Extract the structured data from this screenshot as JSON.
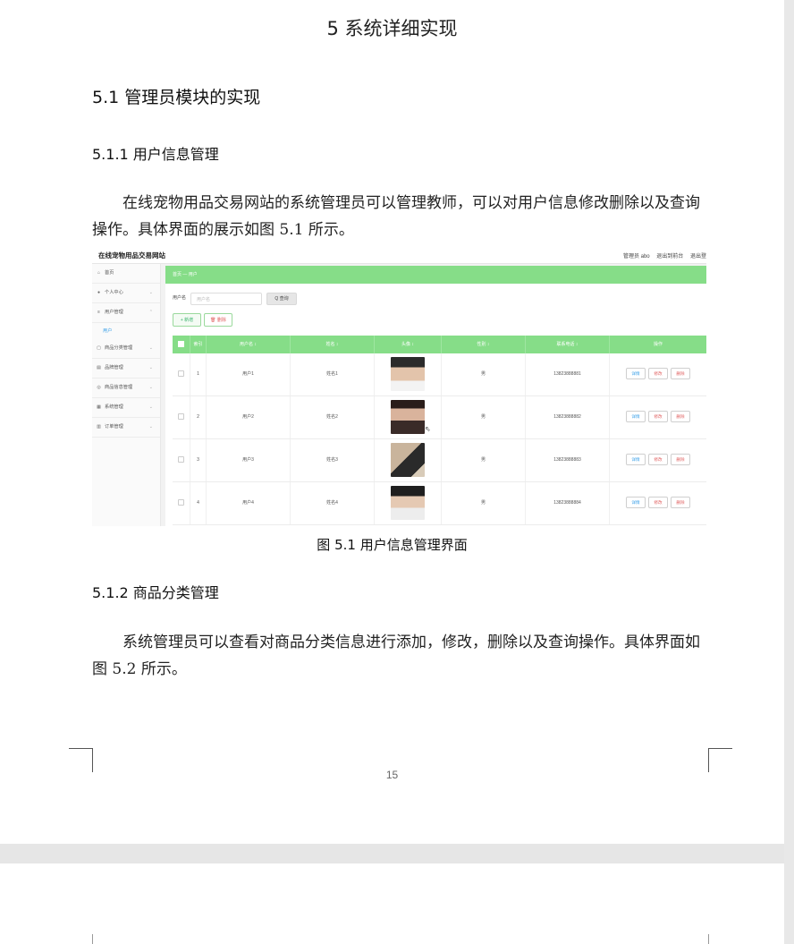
{
  "document": {
    "chapter_title": "5 系统详细实现",
    "section_title": "5.1  管理员模块的实现",
    "subsection_1": "5.1.1  用户信息管理",
    "paragraph_1": "在线宠物用品交易网站的系统管理员可以管理教师，可以对用户信息修改删除以及查询操作。具体界面的展示如图 5.1 所示。",
    "figure_caption": "图 5.1  用户信息管理界面",
    "subsection_2": "5.1.2  商品分类管理",
    "paragraph_2": "系统管理员可以查看对商品分类信息进行添加，修改，删除以及查询操作。具体界面如图 5.2 所示。",
    "page_number": "15"
  },
  "screenshot": {
    "brand": "在线宠物用品交易网站",
    "top_right": [
      "管理员 abo",
      "退出到前台",
      "退出登"
    ],
    "sidebar": [
      {
        "icon": "home-icon",
        "glyph": "⌂",
        "label": "首页"
      },
      {
        "icon": "user-icon",
        "glyph": "●",
        "label": "个人中心"
      },
      {
        "icon": "list-icon",
        "glyph": "≡",
        "label": "用户管理"
      },
      {
        "icon": "category-icon",
        "glyph": "▢",
        "label": "商品分类管理"
      },
      {
        "icon": "brand-icon",
        "glyph": "▤",
        "label": "品牌管理"
      },
      {
        "icon": "goods-icon",
        "glyph": "◎",
        "label": "商品信息管理"
      },
      {
        "icon": "system-icon",
        "glyph": "▦",
        "label": "系统管理"
      },
      {
        "icon": "order-icon",
        "glyph": "▥",
        "label": "订单管理"
      }
    ],
    "sidebar_sub": "用户",
    "breadcrumb": "首页 — 用户",
    "search_label": "用户名",
    "search_placeholder": "用户名",
    "search_button": "Q 查询",
    "add_button": "+ 新增",
    "delete_button": "🗑 删除",
    "table": {
      "headers": [
        "",
        "索引",
        "用户名 ↕",
        "姓名 ↕",
        "头像 ↕",
        "性别 ↕",
        "联系电话 ↕",
        "操作"
      ],
      "rows": [
        {
          "index": "1",
          "username": "用户1",
          "name": "姓名1",
          "gender": "男",
          "phone": "13823888881"
        },
        {
          "index": "2",
          "username": "用户2",
          "name": "姓名2",
          "gender": "男",
          "phone": "13823888882"
        },
        {
          "index": "3",
          "username": "用户3",
          "name": "姓名3",
          "gender": "男",
          "phone": "13823888883"
        },
        {
          "index": "4",
          "username": "用户4",
          "name": "姓名4",
          "gender": "男",
          "phone": "13823888884"
        }
      ],
      "action_labels": [
        "详情",
        "修改",
        "删除"
      ]
    },
    "colors": {
      "accent": "#86dd88",
      "detail": "#3aa0e8",
      "edit": "#e06060",
      "delete": "#e06060"
    }
  }
}
